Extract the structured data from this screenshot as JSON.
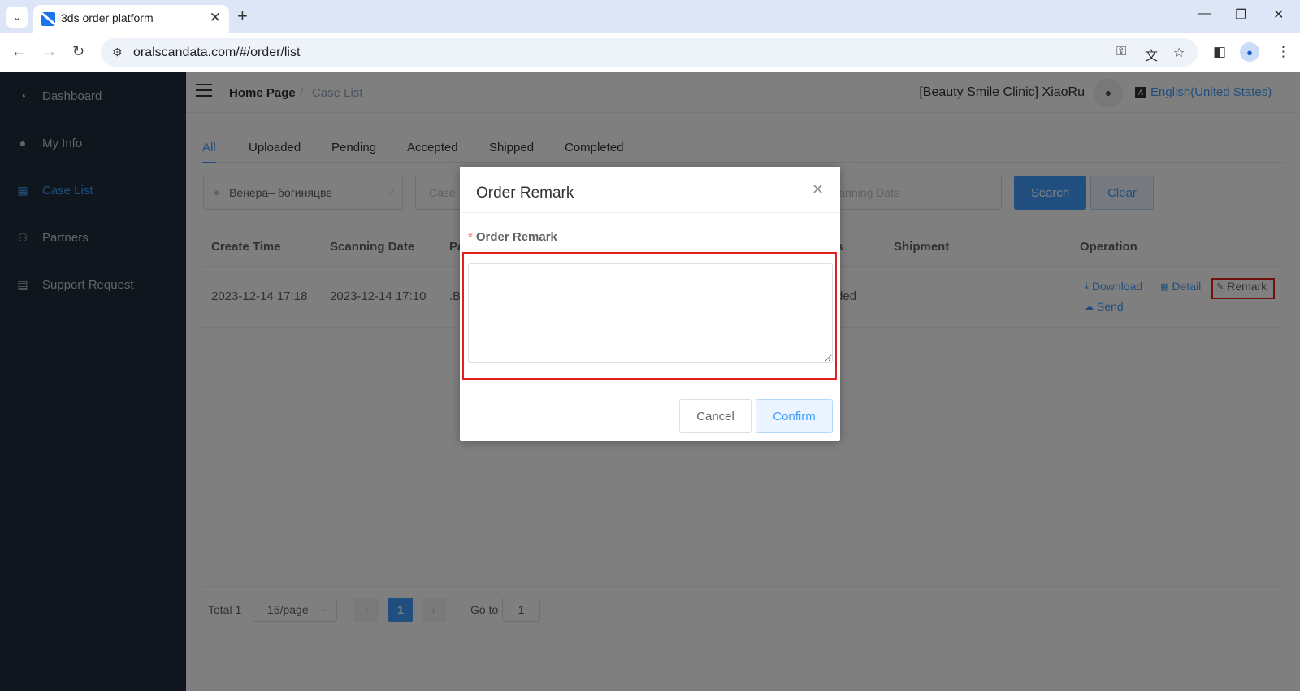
{
  "browser": {
    "tab_title": "3ds order platform",
    "url": "oralscandata.com/#/order/list"
  },
  "sidebar": {
    "items": [
      {
        "label": "Dashboard",
        "icon": "dashboard-icon"
      },
      {
        "label": "My Info",
        "icon": "user-icon"
      },
      {
        "label": "Case List",
        "icon": "grid-icon",
        "active": true
      },
      {
        "label": "Partners",
        "icon": "partners-icon"
      },
      {
        "label": "Support Request",
        "icon": "document-icon"
      }
    ]
  },
  "header": {
    "breadcrumb_home": "Home Page",
    "breadcrumb_sep": "/",
    "breadcrumb_current": "Case List",
    "user": "[Beauty Smile Clinic] XiaoRu",
    "language": "English(United States)"
  },
  "tabs": [
    "All",
    "Uploaded",
    "Pending",
    "Accepted",
    "Shipped",
    "Completed"
  ],
  "filters": {
    "patient_value": "Венера– богиняцве",
    "case_placeholder": "Case",
    "date_placeholder": "Scanning Date",
    "search_label": "Search",
    "clear_label": "Clear"
  },
  "table": {
    "columns": [
      "Create Time",
      "Scanning Date",
      "Pa",
      "s",
      "Shipment",
      "Operation"
    ],
    "rows": [
      {
        "create_time": "2023-12-14 17:18",
        "scanning_date": "2023-12-14 17:10",
        "patient": ".B",
        "status": "ded",
        "shipment": ""
      }
    ],
    "operations": {
      "download": "Download",
      "detail": "Detail",
      "remark": "Remark",
      "send": "Send"
    }
  },
  "pagination": {
    "total": "Total 1",
    "page_size": "15/page",
    "current_page": "1",
    "goto_label": "Go to",
    "goto_value": "1"
  },
  "dialog": {
    "title": "Order Remark",
    "required_mark": "*",
    "field_label": "Order Remark",
    "field_value": "",
    "cancel_label": "Cancel",
    "confirm_label": "Confirm"
  },
  "colors": {
    "primary": "#409eff",
    "sidebar_bg": "#1f2d3d",
    "highlight": "#e0201f"
  }
}
